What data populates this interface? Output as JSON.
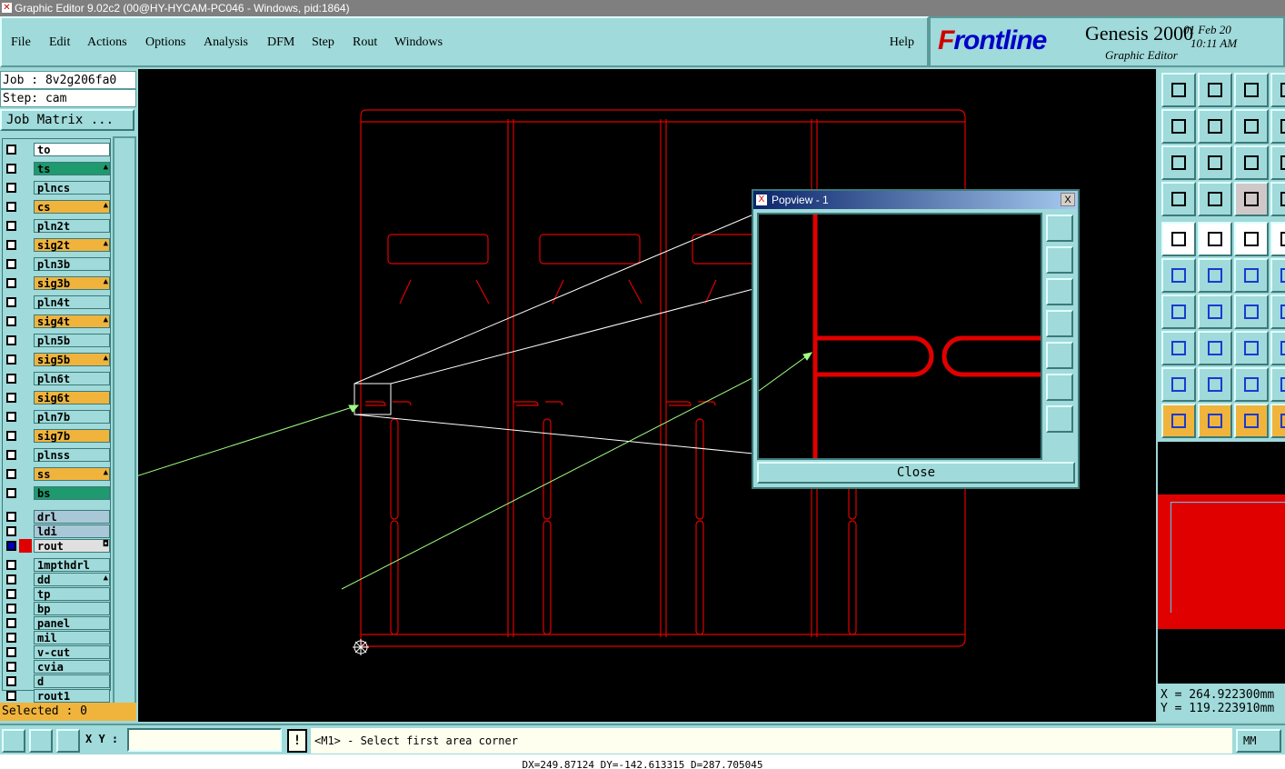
{
  "window": {
    "title": "Graphic Editor 9.02c2 (00@HY-HYCAM-PC046 - Windows, pid:1864)"
  },
  "menu": {
    "items": [
      "File",
      "Edit",
      "Actions",
      "Options",
      "Analysis",
      "DFM",
      "Step",
      "Rout",
      "Windows"
    ],
    "help": "Help"
  },
  "brand": {
    "logo_prefix": "F",
    "logo_rest": "rontline",
    "product": "Genesis 2000",
    "subtitle": "Graphic Editor",
    "date": "01 Feb 20",
    "time": "10:11 AM"
  },
  "job": {
    "job_line": "Job : 8v2g206fa0",
    "step_line": "Step: cam",
    "matrix_button": "Job Matrix ..."
  },
  "layers": [
    {
      "name": "to",
      "color": "#ffffff",
      "marker": ""
    },
    {
      "name": "ts",
      "color": "#1e9a6e",
      "marker": "▲"
    },
    {
      "name": "plncs",
      "color": "#a0dada",
      "marker": ""
    },
    {
      "name": "cs",
      "color": "#f0b43c",
      "marker": "▲"
    },
    {
      "name": "pln2t",
      "color": "#a0dada",
      "marker": ""
    },
    {
      "name": "sig2t",
      "color": "#f0b43c",
      "marker": "▲"
    },
    {
      "name": "pln3b",
      "color": "#a0dada",
      "marker": ""
    },
    {
      "name": "sig3b",
      "color": "#f0b43c",
      "marker": "▲"
    },
    {
      "name": "pln4t",
      "color": "#a0dada",
      "marker": ""
    },
    {
      "name": "sig4t",
      "color": "#f0b43c",
      "marker": "▲"
    },
    {
      "name": "pln5b",
      "color": "#a0dada",
      "marker": ""
    },
    {
      "name": "sig5b",
      "color": "#f0b43c",
      "marker": "▲"
    },
    {
      "name": "pln6t",
      "color": "#a0dada",
      "marker": ""
    },
    {
      "name": "sig6t",
      "color": "#f0b43c",
      "marker": ""
    },
    {
      "name": "pln7b",
      "color": "#a0dada",
      "marker": ""
    },
    {
      "name": "sig7b",
      "color": "#f0b43c",
      "marker": ""
    },
    {
      "name": "plnss",
      "color": "#a0dada",
      "marker": ""
    },
    {
      "name": "ss",
      "color": "#f0b43c",
      "marker": "▲"
    },
    {
      "name": "bs",
      "color": "#1e9a6e",
      "marker": ""
    },
    {
      "name": "drl",
      "color": "#a8c8d8",
      "marker": ""
    },
    {
      "name": "ldi",
      "color": "#a8c8d8",
      "marker": ""
    },
    {
      "name": "rout",
      "color": "#e0e0e0",
      "marker": "◘"
    },
    {
      "name": "1mpthdrl",
      "color": "#a0dada",
      "marker": ""
    },
    {
      "name": "dd",
      "color": "#a0dada",
      "marker": "▲"
    },
    {
      "name": "tp",
      "color": "#a0dada",
      "marker": ""
    },
    {
      "name": "bp",
      "color": "#a0dada",
      "marker": ""
    },
    {
      "name": "panel",
      "color": "#a0dada",
      "marker": ""
    },
    {
      "name": "mil",
      "color": "#a0dada",
      "marker": ""
    },
    {
      "name": "v-cut",
      "color": "#a0dada",
      "marker": ""
    },
    {
      "name": "cvia",
      "color": "#a0dada",
      "marker": ""
    },
    {
      "name": "d",
      "color": "#a0dada",
      "marker": ""
    },
    {
      "name": "rout1",
      "color": "#a0dada",
      "marker": ""
    }
  ],
  "selected": "Selected : 0",
  "popview": {
    "title": "Popview - 1",
    "close_label": "Close",
    "close_x": "X"
  },
  "coords": {
    "x": "X = 264.922300mm",
    "y": "Y = 119.223910mm"
  },
  "status": {
    "xy_label": "X Y :",
    "xy_value": "",
    "bang": "!",
    "prompt": "<M1> - Select first area corner",
    "units": "MM",
    "bottom": "DX=249.87124 DY=-142.613315 D=287.705045"
  },
  "colors": {
    "panel": "#a0dada",
    "canvas": "#000000",
    "outline": "#e00000",
    "highlight": "#f0b43c"
  }
}
